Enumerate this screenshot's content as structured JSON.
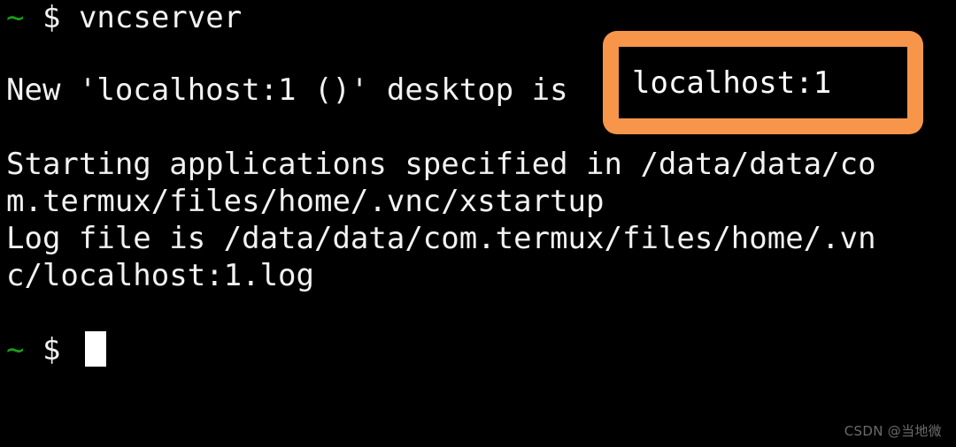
{
  "terminal": {
    "background_color": "#000000",
    "foreground_color": "#f2f2f2",
    "prompt_symbol_color": "#19a019",
    "prompt_tilde": "~",
    "prompt_dollar": "$",
    "command_line": {
      "tilde": "~",
      "dollar": "$",
      "command": "vncserver"
    },
    "output_lines": [
      "New 'localhost:1 ()' desktop is localhost:1",
      "Starting applications specified in /data/data/co",
      "m.termux/files/home/.vnc/xstartup",
      "Log file is /data/data/com.termux/files/home/.vn",
      "c/localhost:1.log"
    ],
    "line_new_desktop": "New 'localhost:1 ()' desktop is",
    "line_starting": "Starting applications specified in /data/data/co",
    "line_xstartup": "m.termux/files/home/.vnc/xstartup",
    "line_logfile": "Log file is /data/data/com.termux/files/home/.vn",
    "line_logfile_cont": "c/localhost:1.log",
    "final_prompt": {
      "tilde": "~",
      "dollar": "$"
    },
    "cursor": "block"
  },
  "annotation": {
    "highlighted_text": "localhost:1",
    "border_color": "#f7954a",
    "shape": "rounded-rectangle"
  },
  "watermark": {
    "text": "CSDN @当地微",
    "color": "#6b6b6b"
  }
}
